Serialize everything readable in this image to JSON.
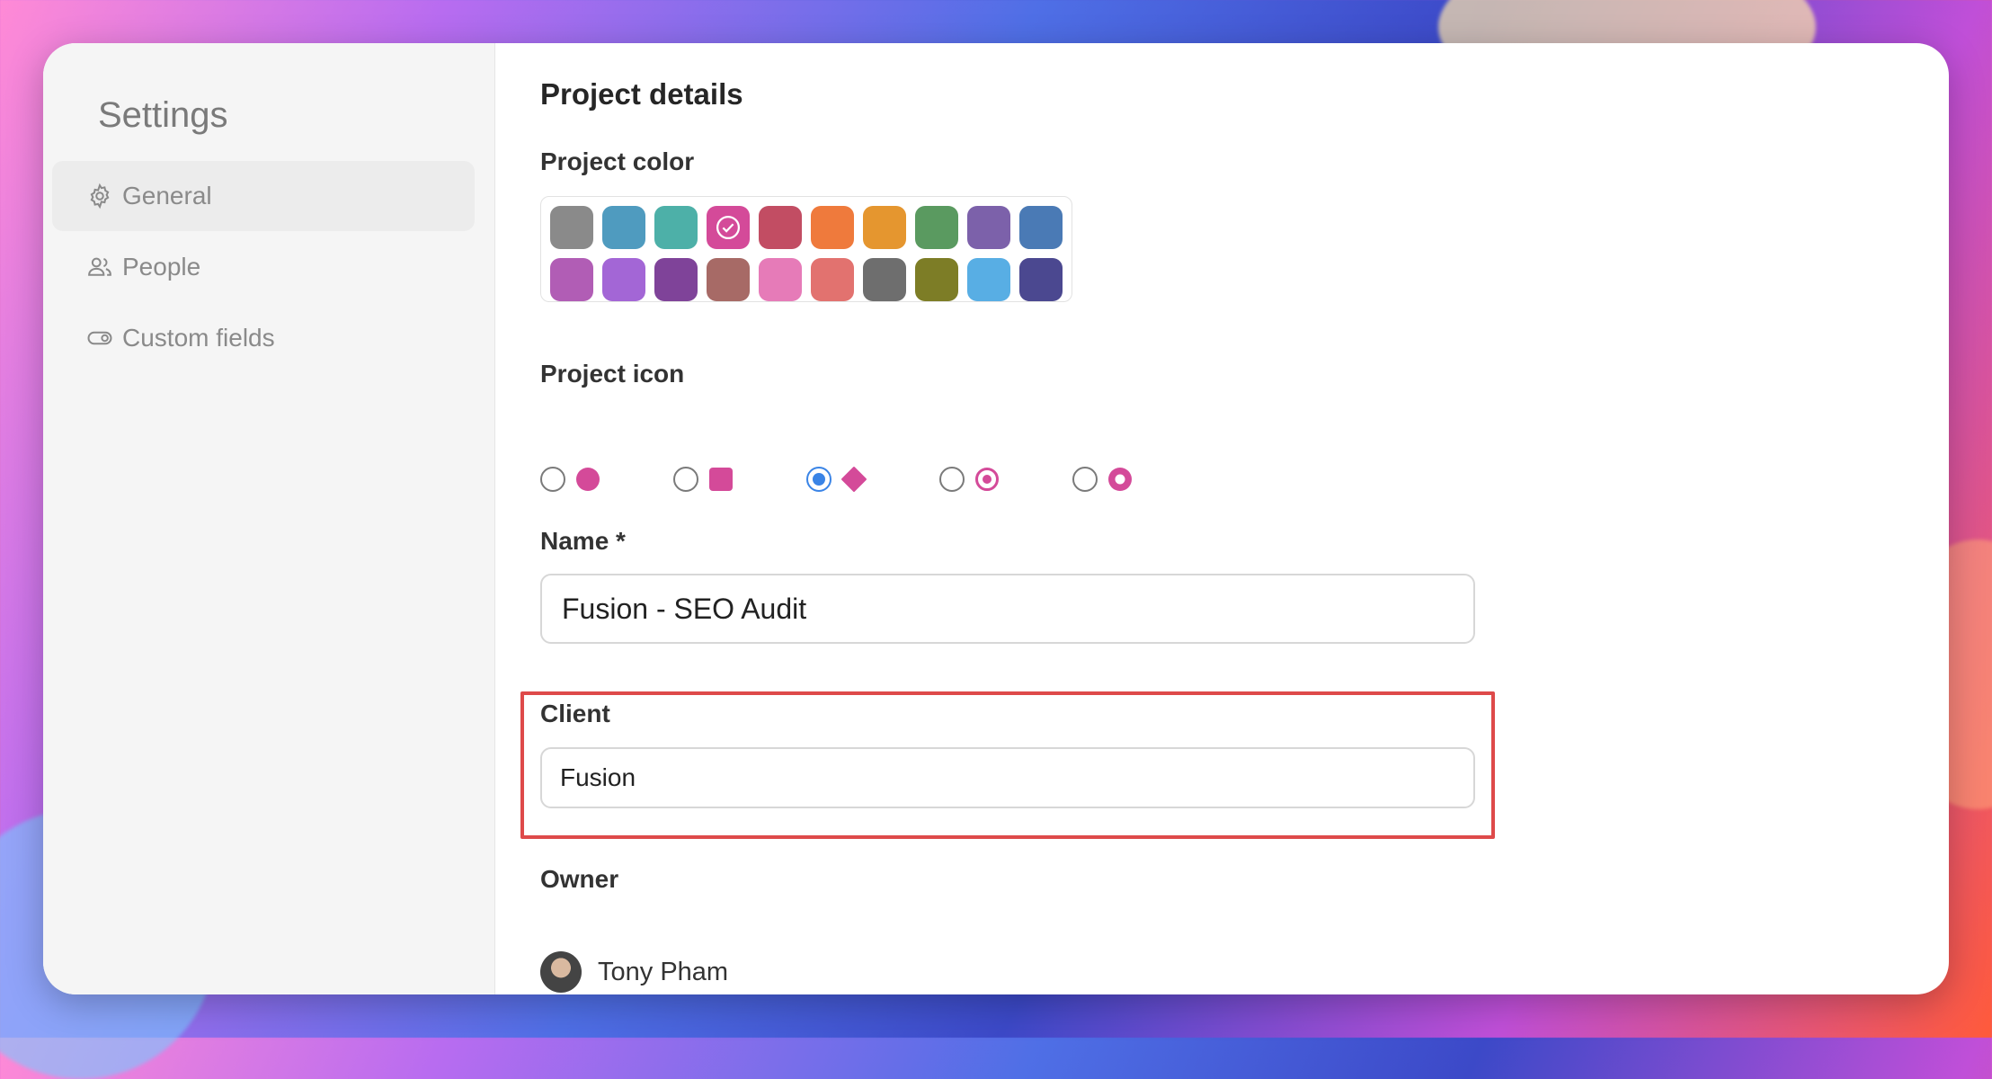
{
  "sidebar": {
    "title": "Settings",
    "items": [
      {
        "label": "General",
        "icon": "gear-icon",
        "active": true
      },
      {
        "label": "People",
        "icon": "people-icon",
        "active": false
      },
      {
        "label": "Custom fields",
        "icon": "toggle-icon",
        "active": false
      }
    ]
  },
  "main": {
    "heading": "Project details",
    "color_label": "Project color",
    "colors": [
      "#8a8a8a",
      "#4f9bbf",
      "#4db0a8",
      "#d44a99",
      "#c24d63",
      "#ef7a3c",
      "#e5962f",
      "#5a9a60",
      "#7c61aa",
      "#4a7ab5",
      "#b15db5",
      "#a366d6",
      "#7f4399",
      "#a76a66",
      "#e67bb8",
      "#e2726f",
      "#6e6e6e",
      "#7d7d26",
      "#58aee4",
      "#4b4890"
    ],
    "selected_color_index": 3,
    "icon_label": "Project icon",
    "icon_options": [
      {
        "shape": "circle-icon",
        "selected": false
      },
      {
        "shape": "square-icon",
        "selected": false
      },
      {
        "shape": "diamond-icon",
        "selected": true
      },
      {
        "shape": "ring-dot-icon",
        "selected": false
      },
      {
        "shape": "circle-dot-icon",
        "selected": false
      }
    ],
    "icon_color": "#d44a99",
    "name_label": "Name *",
    "name_value": "Fusion - SEO Audit",
    "client_label": "Client",
    "client_value": "Fusion",
    "owner_label": "Owner",
    "owner_name": "Tony Pham"
  }
}
